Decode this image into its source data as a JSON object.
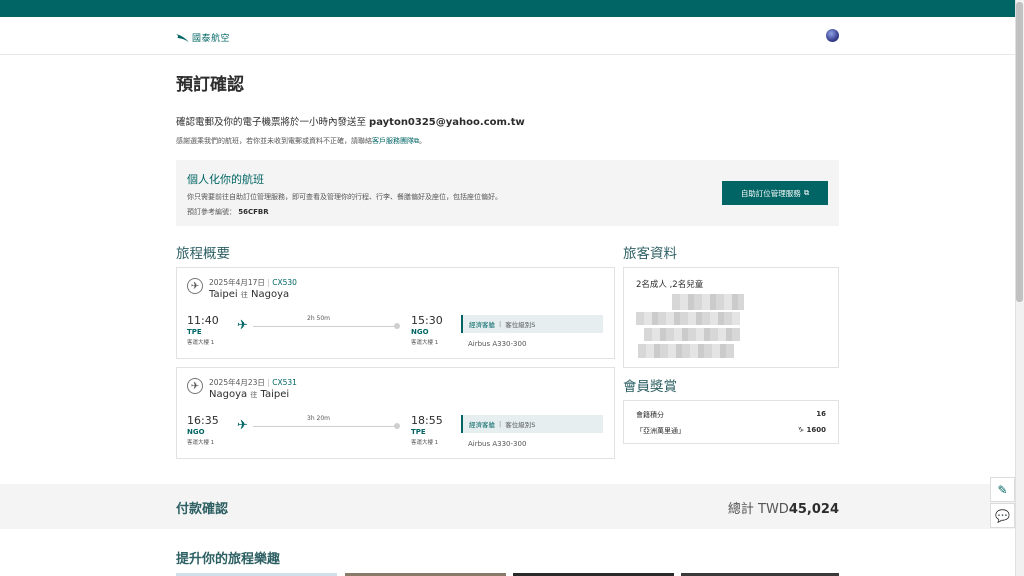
{
  "brand": {
    "logo_text": "國泰航空",
    "accent": "#006564"
  },
  "page": {
    "title": "預訂確認"
  },
  "confirmation": {
    "email_prefix": "確認電郵及你的電子機票將於一小時內發送至",
    "email": "payton0325@yahoo.com.tw",
    "note_prefix": "感謝選乘我們的航班，若你並未收到電郵或資料不正確，請聯絡",
    "note_link": "客戶服務團隊",
    "note_suffix": "。"
  },
  "personalize": {
    "title": "個人化你的航班",
    "desc": "你只需要前往自助訂位管理服務，即可查看及管理你的行程、行李、餐膳偏好及座位，包括座位偏好。",
    "ref_label": "預訂參考編號：",
    "ref_value": "56CFBR",
    "button_label": "自助訂位管理服務"
  },
  "itinerary": {
    "heading": "旅程概要",
    "flights": [
      {
        "date": "2025年4月17日",
        "flight_no": "CX530",
        "origin_city": "Taipei",
        "connector": "往",
        "dest_city": "Nagoya",
        "dep_time": "11:40",
        "dep_code": "TPE",
        "dep_terminal": "客運大樓 1",
        "duration": "2h 50m",
        "arr_time": "15:30",
        "arr_code": "NGO",
        "arr_terminal": "客運大樓 1",
        "cabin": "經濟客艙",
        "fare_class": "客位級別S",
        "aircraft": "Airbus A330-300"
      },
      {
        "date": "2025年4月23日",
        "flight_no": "CX531",
        "origin_city": "Nagoya",
        "connector": "往",
        "dest_city": "Taipei",
        "dep_time": "16:35",
        "dep_code": "NGO",
        "dep_terminal": "客運大樓 1",
        "duration": "3h 20m",
        "arr_time": "18:55",
        "arr_code": "TPE",
        "arr_terminal": "客運大樓 1",
        "cabin": "經濟客艙",
        "fare_class": "客位級別S",
        "aircraft": "Airbus A330-300"
      }
    ]
  },
  "passengers": {
    "heading": "旅客資料",
    "summary": "2名成人 ,2名兒童"
  },
  "rewards": {
    "heading": "會員獎賞",
    "rows": [
      {
        "label": "會籍積分",
        "value": "16"
      },
      {
        "label": "「亞洲萬里通」",
        "value": "♑ 1600"
      }
    ]
  },
  "payment": {
    "heading": "付款確認",
    "total_label": "總計 TWD",
    "total_value": "45,024"
  },
  "enhance": {
    "heading": "提升你的旅程樂趣"
  }
}
